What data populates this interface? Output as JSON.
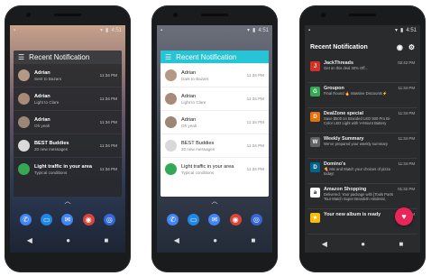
{
  "status_time": "4:51",
  "phones": [
    {
      "theme": "dark",
      "header_title": "Recent Notification",
      "header_bg": "#3c3d40",
      "rows": [
        {
          "title": "Adrian",
          "sub": "Sent to Bazars",
          "time": "11:34 PM",
          "avatar": "#b49a86"
        },
        {
          "title": "Adrian",
          "sub": "Light to Clare",
          "time": "11:34 PM",
          "avatar": "#a88a78"
        },
        {
          "title": "Adrian",
          "sub": "Oh yeah",
          "time": "11:34 PM",
          "avatar": "#9c8676"
        },
        {
          "title": "BEST Buddies",
          "sub": "20 new messages",
          "time": "11:34 PM",
          "avatar": "#d9d9d9"
        },
        {
          "title": "Light traffic in your area",
          "sub": "Typical conditions",
          "time": "11:34 PM",
          "avatar": "#34a853"
        }
      ]
    },
    {
      "theme": "light",
      "header_title": "Recent Notification",
      "header_bg": "#27c4d6",
      "rows": [
        {
          "title": "Adrian",
          "sub": "Dark to Bazars",
          "time": "11:34 PM",
          "avatar": "#b49a86"
        },
        {
          "title": "Adrian",
          "sub": "Light to Clare",
          "time": "11:34 PM",
          "avatar": "#a88a78"
        },
        {
          "title": "Adrian",
          "sub": "Oh yeah",
          "time": "11:34 PM",
          "avatar": "#9c8676"
        },
        {
          "title": "BEST Buddies",
          "sub": "20 new messages",
          "time": "11:34 PM",
          "avatar": "#d9d9d9"
        },
        {
          "title": "Light traffic in your area",
          "sub": "Typical conditions",
          "time": "11:34 PM",
          "avatar": "#34a853"
        }
      ]
    }
  ],
  "phone3": {
    "header_title": "Recent Notification",
    "rows": [
      {
        "title": "JackThreads",
        "sub": "Get on this deal 30% Off...",
        "time": "02:42 PM",
        "color": "#d93025",
        "letter": "J"
      },
      {
        "title": "Groupon",
        "sub": "Final Round 🔥 Massive Discounts⚡",
        "time": "11:34 PM",
        "color": "#34a853",
        "letter": "G"
      },
      {
        "title": "DealZone special",
        "sub": "Save $500 on Branded LED 500 Pro Bi-Color LED Light with V-Mount Battery Plate",
        "time": "11:34 PM",
        "color": "#e8710a",
        "letter": "D"
      },
      {
        "title": "Weekly Summary",
        "sub": "We've prepared your weekly summary",
        "time": "11:34 PM",
        "color": "#5f6368",
        "letter": "W"
      },
      {
        "title": "Domino's",
        "sub": "🍕 Mix and Match your choices of pizza today!",
        "time": "11:34 PM",
        "color": "#006491",
        "letter": "D"
      },
      {
        "title": "Amazon Shopping",
        "sub": "Delivered: Your package with [Tools Parts Tour Match Super Brandish Hinderal, Rare Parking / Orange / L...",
        "time": "01:32 PM",
        "color": "#ffffff",
        "letter": "a"
      },
      {
        "title": "Your new album is ready",
        "sub": "",
        "time": "01:30 PM",
        "color": "#fbbc05",
        "letter": "★"
      }
    ]
  },
  "colors": {
    "fab": "#e9255a",
    "dark_card": "#3a3b3e",
    "light_card": "#ffffff"
  }
}
